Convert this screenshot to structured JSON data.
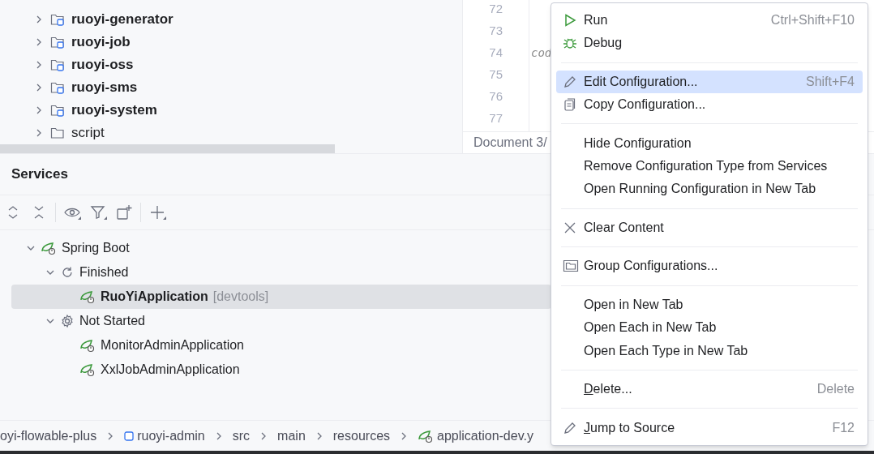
{
  "project_tree": [
    {
      "label": "ruoyi-generator",
      "kind": "module"
    },
    {
      "label": "ruoyi-job",
      "kind": "module"
    },
    {
      "label": "ruoyi-oss",
      "kind": "module"
    },
    {
      "label": "ruoyi-sms",
      "kind": "module"
    },
    {
      "label": "ruoyi-system",
      "kind": "module"
    },
    {
      "label": "script",
      "kind": "folder"
    }
  ],
  "editor": {
    "lines": [
      {
        "number": "72"
      },
      {
        "number": "73"
      },
      {
        "number": "74",
        "text": "cod"
      },
      {
        "number": "75"
      },
      {
        "number": "76"
      },
      {
        "number": "77"
      }
    ],
    "status": "Document 3/"
  },
  "services": {
    "title": "Services",
    "tree": [
      {
        "label": "Spring Boot",
        "kind": "spring",
        "expanded": true,
        "selected": false,
        "children": [
          {
            "label": "Finished",
            "kind": "finished",
            "expanded": true,
            "selected": false,
            "children": [
              {
                "label": "RuoYiApplication",
                "tag": "[devtools]",
                "kind": "app",
                "selected": true
              }
            ]
          },
          {
            "label": "Not Started",
            "kind": "not_started",
            "expanded": true,
            "selected": false,
            "children": [
              {
                "label": "MonitorAdminApplication",
                "kind": "app",
                "selected": false
              },
              {
                "label": "XxlJobAdminApplication",
                "kind": "app",
                "selected": false
              }
            ]
          }
        ]
      }
    ]
  },
  "breadcrumb": [
    {
      "label": "oyi-flowable-plus",
      "kind": "text"
    },
    {
      "label": "ruoyi-admin",
      "kind": "module"
    },
    {
      "label": "src",
      "kind": "text"
    },
    {
      "label": "main",
      "kind": "text"
    },
    {
      "label": "resources",
      "kind": "text"
    },
    {
      "label": "application-dev.y",
      "kind": "spring"
    }
  ],
  "context_menu": [
    {
      "kind": "item",
      "label": "Run",
      "shortcut": "Ctrl+Shift+F10",
      "selected": false
    },
    {
      "kind": "item",
      "label": "Debug",
      "selected": false
    },
    {
      "kind": "separator"
    },
    {
      "kind": "item",
      "label": "Edit Configuration...",
      "shortcut": "Shift+F4",
      "selected": true
    },
    {
      "kind": "item",
      "label": "Copy Configuration...",
      "selected": false
    },
    {
      "kind": "separator"
    },
    {
      "kind": "item",
      "label": "Hide Configuration",
      "selected": false
    },
    {
      "kind": "item",
      "label": "Remove Configuration Type from Services",
      "selected": false
    },
    {
      "kind": "item",
      "label": "Open Running Configuration in New Tab",
      "selected": false
    },
    {
      "kind": "separator"
    },
    {
      "kind": "item",
      "label": "Clear Content",
      "selected": false
    },
    {
      "kind": "separator"
    },
    {
      "kind": "item",
      "label": "Group Configurations...",
      "selected": false
    },
    {
      "kind": "separator"
    },
    {
      "kind": "item",
      "label": "Open in New Tab",
      "selected": false
    },
    {
      "kind": "item",
      "label": "Open Each in New Tab",
      "selected": false
    },
    {
      "kind": "item",
      "label": "Open Each Type in New Tab",
      "selected": false
    },
    {
      "kind": "separator"
    },
    {
      "kind": "item",
      "label": "Delete...",
      "shortcut": "Delete",
      "mnemonic": true,
      "selected": false
    },
    {
      "kind": "separator"
    },
    {
      "kind": "item",
      "label": "Jump to Source",
      "shortcut": "F12",
      "mnemonic": true,
      "selected": false
    }
  ]
}
